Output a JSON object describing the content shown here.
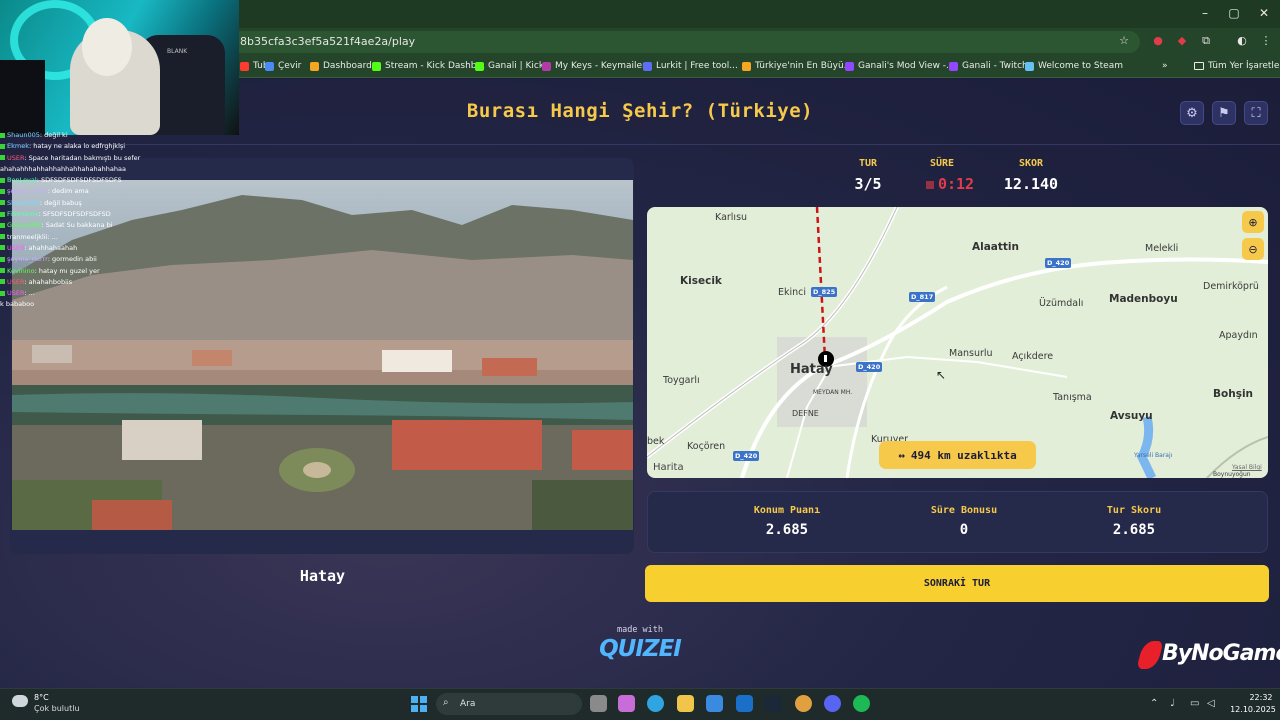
{
  "browser": {
    "url": "8b35cfa3c3ef5a521f4ae2a/play",
    "window_controls": [
      "–",
      "▢",
      "✕"
    ],
    "bookmarks": [
      {
        "label": "Tube",
        "color": "#ff3b30"
      },
      {
        "label": "Çevir",
        "color": "#4a8af4"
      },
      {
        "label": "Dashboard",
        "color": "#f5a623"
      },
      {
        "label": "Stream - Kick Dashb...",
        "color": "#53fc18"
      },
      {
        "label": "Ganali | Kick",
        "color": "#53fc18"
      },
      {
        "label": "My Keys - Keymailer",
        "color": "#b33aa8"
      },
      {
        "label": "Lurkit | Free tool...",
        "color": "#5b6ef5"
      },
      {
        "label": "Türkiye'nin En Büyü...",
        "color": "#f5a623"
      },
      {
        "label": "Ganali's Mod View -...",
        "color": "#9146ff"
      },
      {
        "label": "Ganali - Twitch",
        "color": "#9146ff"
      },
      {
        "label": "Welcome to Steam",
        "color": "#66c0f4"
      }
    ],
    "all_bookmarks_label": "Tüm Yer İşaretleri"
  },
  "webcam": {
    "chair_brand": "BLANK"
  },
  "chat": [
    {
      "name": "Shaun005",
      "msg": ": değil ki"
    },
    {
      "name": "Ekmek",
      "msg": ": hatay ne alaka lo edfrghjklşi"
    },
    {
      "name": "USER",
      "msg": ": Space haritadan bakmıştı bu sefer"
    },
    {
      "name": "",
      "msg": "ahahahhhahhahhahhahhahahahhahaa"
    },
    {
      "name": "BenLoyal",
      "msg": ": SDFSDFSDFSDFSDFSDFS"
    },
    {
      "name": "şeyma_nurrr",
      "msg": ": dedim ama"
    },
    {
      "name": "Shaun005",
      "msg": ": değil babuş"
    },
    {
      "name": "Fiboname",
      "msg": ": SFSDFSDFSDFSDFSD"
    },
    {
      "name": "GokaySMK",
      "msg": ": Sadat Su bakkana bi"
    },
    {
      "name": "tranmeeljklii",
      "msg": ": ..."
    },
    {
      "name": "USER",
      "msg": ": ahahhahaahah"
    },
    {
      "name": "şeyma_nurrr",
      "msg": ": gormedin abii"
    },
    {
      "name": "Kevinino",
      "msg": ": hatay mı guzel yer"
    },
    {
      "name": "USER",
      "msg": ": ahahahbobiis"
    },
    {
      "name": "USER",
      "msg": ": ..."
    },
    {
      "name": "",
      "msg": "k bababoo"
    }
  ],
  "game": {
    "title": "Burası Hangi Şehir? (Türkiye)",
    "header_buttons": [
      "settings-icon",
      "flag-icon",
      "fullscreen-icon"
    ],
    "answer_city": "Hatay",
    "stats": {
      "round_label": "TUR",
      "round_value": "3/5",
      "time_label": "SÜRE",
      "time_value": "0:12",
      "score_label": "SKOR",
      "score_value": "12.140"
    },
    "map": {
      "labels": {
        "karlisu": "Karlısu",
        "alaattin": "Alaattin",
        "melekli": "Melekli",
        "kisecik": "Kisecik",
        "ekinci": "Ekinci",
        "uzumdali": "Üzümdalı",
        "madenboyu": "Madenboyu",
        "demirkopru": "Demirköprü",
        "apaydin": "Apaydın",
        "mansurlu": "Mansurlu",
        "acikdere": "Açıkdere",
        "toygarli": "Toygarlı",
        "hatay": "Hatay",
        "meydan": "MEYDAN MH.",
        "defne": "DEFNE",
        "tanisma": "Tanışma",
        "bohsin": "Bohşin",
        "avsuyu": "Avsuyu",
        "bek": "bek",
        "kocoren": "Koçören",
        "kuruyer": "Kuruyer",
        "yarseli": "Yarseli Barajı",
        "boynuyogun": "Boynuyoğun"
      },
      "roads": {
        "d420a": "D_420",
        "d825": "D_825",
        "d817": "D_817",
        "d420b": "D_420",
        "d420c": "D_420"
      },
      "attribution": "Harita",
      "legal": "Yasal Bilgi",
      "distance": "494 km uzaklıkta"
    },
    "round_score": {
      "location_label": "Konum Puanı",
      "location_value": "2.685",
      "time_bonus_label": "Süre Bonusu",
      "time_bonus_value": "0",
      "round_total_label": "Tur Skoru",
      "round_total_value": "2.685"
    },
    "next_button": "SONRAKİ TUR",
    "made_with": "made with",
    "brand": "QUIZEI",
    "sponsor": "ByNoGame"
  },
  "taskbar": {
    "temperature": "8°C",
    "weather": "Çok bulutlu",
    "search_placeholder": "Ara",
    "time": "22:32",
    "date": "12.10.2025"
  }
}
